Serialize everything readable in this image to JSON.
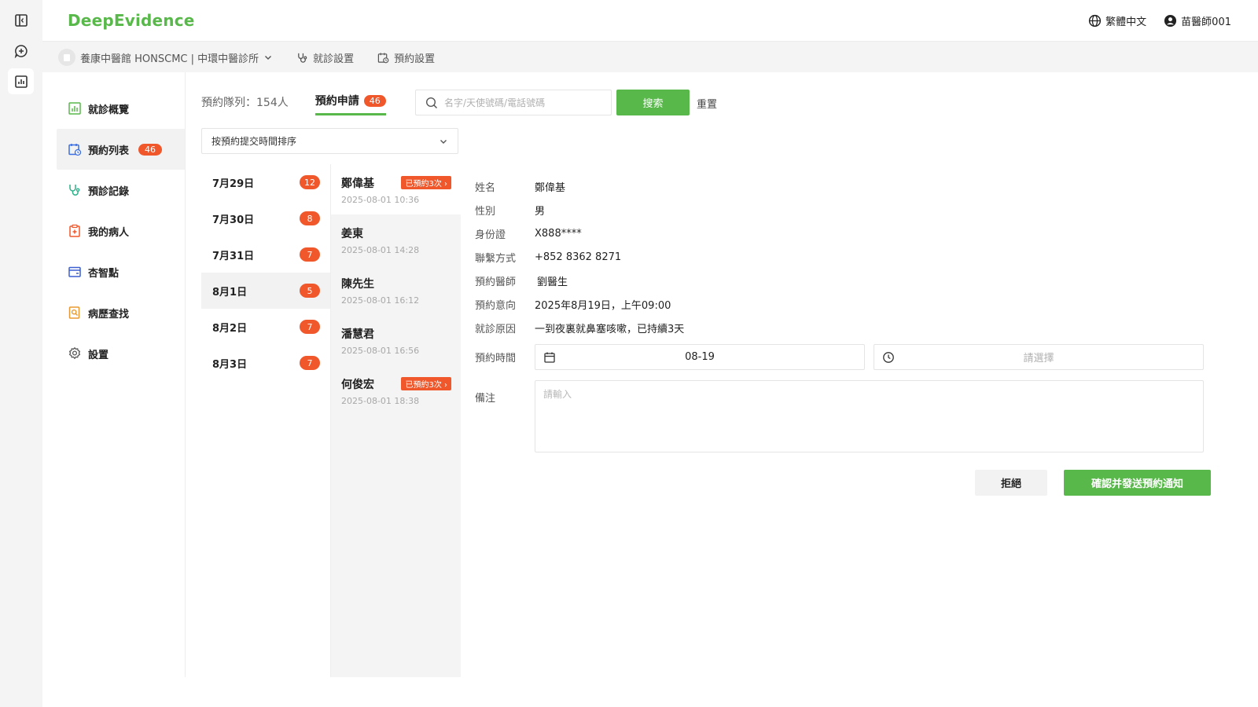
{
  "app": {
    "logo": "DeepEvidence"
  },
  "header": {
    "language": "繁體中文",
    "user": "苗醫師001"
  },
  "subbar": {
    "clinic": "養康中醫館 HONSCMC | 中環中醫診所",
    "consult_settings": "就診設置",
    "booking_settings": "預約設置"
  },
  "sidebar": {
    "items": [
      {
        "label": "就診概覽",
        "icon": "chart-icon"
      },
      {
        "label": "預約列表",
        "icon": "calendar-icon",
        "badge": "46"
      },
      {
        "label": "預診記錄",
        "icon": "stethoscope-icon"
      },
      {
        "label": "我的病人",
        "icon": "patient-file-icon"
      },
      {
        "label": "杏智點",
        "icon": "wallet-icon"
      },
      {
        "label": "病歷查找",
        "icon": "record-search-icon"
      },
      {
        "label": "設置",
        "icon": "gear-icon"
      }
    ]
  },
  "tabs": {
    "queue": "預約隊列：154人",
    "requests": "預約申請",
    "requests_badge": "46"
  },
  "search": {
    "placeholder": "名字/天使號碼/電話號碼",
    "button": "搜索",
    "reset": "重置"
  },
  "sort": {
    "selected": "按預約提交時間排序"
  },
  "dates": [
    {
      "label": "7月29日",
      "count": "12"
    },
    {
      "label": "7月30日",
      "count": "8"
    },
    {
      "label": "7月31日",
      "count": "7"
    },
    {
      "label": "8月1日",
      "count": "5"
    },
    {
      "label": "8月2日",
      "count": "7"
    },
    {
      "label": "8月3日",
      "count": "7"
    }
  ],
  "patients": [
    {
      "name": "鄭偉基",
      "time": "2025-08-01 10:36",
      "tag": "已預約3次 ›"
    },
    {
      "name": "姜東",
      "time": "2025-08-01 14:28"
    },
    {
      "name": "陳先生",
      "time": "2025-08-01 16:12"
    },
    {
      "name": "潘慧君",
      "time": "2025-08-01 16:56"
    },
    {
      "name": "何俊宏",
      "time": "2025-08-01 18:38",
      "tag": "已預約3次 ›"
    }
  ],
  "detail": {
    "name_label": "姓名",
    "name": "鄭偉基",
    "gender_label": "性別",
    "gender": "男",
    "id_label": "身份證",
    "id": "X888****",
    "contact_label": "聯繫方式",
    "contact": "+852 8362 8271",
    "doctor_label": "預約醫師",
    "doctor": "劉醫生",
    "intent_label": "預約意向",
    "intent": "2025年8月19日，上午09:00",
    "reason_label": "就診原因",
    "reason": "一到夜裏就鼻塞咳嗽，已持續3天",
    "time_label": "預約時間",
    "date_value": "08-19",
    "time_placeholder": "請選擇",
    "notes_label": "備注",
    "notes_placeholder": "請輸入"
  },
  "actions": {
    "reject": "拒絕",
    "confirm": "確認并發送預約通知"
  },
  "colors": {
    "brand_green": "#58b84a",
    "badge_orange": "#f0582b"
  }
}
